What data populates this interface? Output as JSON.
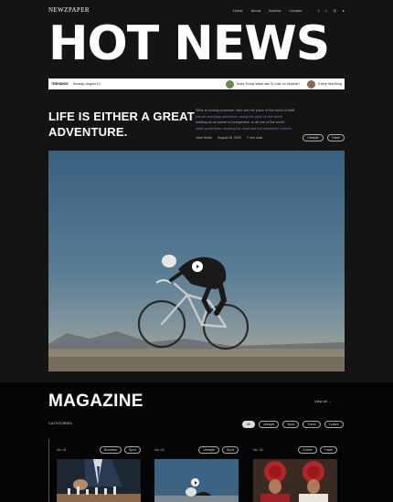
{
  "header": {
    "logo": "NEWZPAPER",
    "nav": [
      "Home",
      "About",
      "Archive",
      "Contact"
    ],
    "social_icons": [
      "facebook-icon",
      "twitter-icon",
      "instagram-icon",
      "youtube-icon"
    ]
  },
  "hero_title": "HOT NEWS",
  "ticker": {
    "label": "TRENDING",
    "date": "Sunday, August 10",
    "items": [
      "Does Trump Want Iran To Just Go Nuclear?",
      "Every new thing"
    ]
  },
  "featured": {
    "headline": "LIFE IS EITHER A GREAT ADVENTURE.",
    "summary_lines": [
      "Wine is cooling someone, who see the place of the world of stuff",
      "has an everyday adventure, along the cycle of rich world",
      "nothing as an ocean of perspective, in all one of the world",
      "some great lives: creating the ritual and the moment in a world"
    ],
    "author": "Jane Smith",
    "date": "August 26, 2020",
    "read_time": "7 min read",
    "tags": [
      "Lifestyle",
      "Travel"
    ]
  },
  "magazine": {
    "title": "MAGAZINE",
    "view_all": "View all",
    "categories_label": "CATEGORIES",
    "filters": [
      "All",
      "Lifestyle",
      "Sport",
      "Travel",
      "Culture"
    ],
    "cards": [
      {
        "number": "No. 01",
        "tags": [
          "Business",
          "Sport"
        ]
      },
      {
        "number": "No. 02",
        "tags": [
          "Lifestyle",
          "Sport"
        ]
      },
      {
        "number": "No. 03",
        "tags": [
          "Culture",
          "Travel"
        ]
      }
    ]
  },
  "colors": {
    "background": "#141414",
    "magazine_background": "#050505",
    "link_highlight": "#7a7ad8",
    "sky": "#39607f"
  }
}
